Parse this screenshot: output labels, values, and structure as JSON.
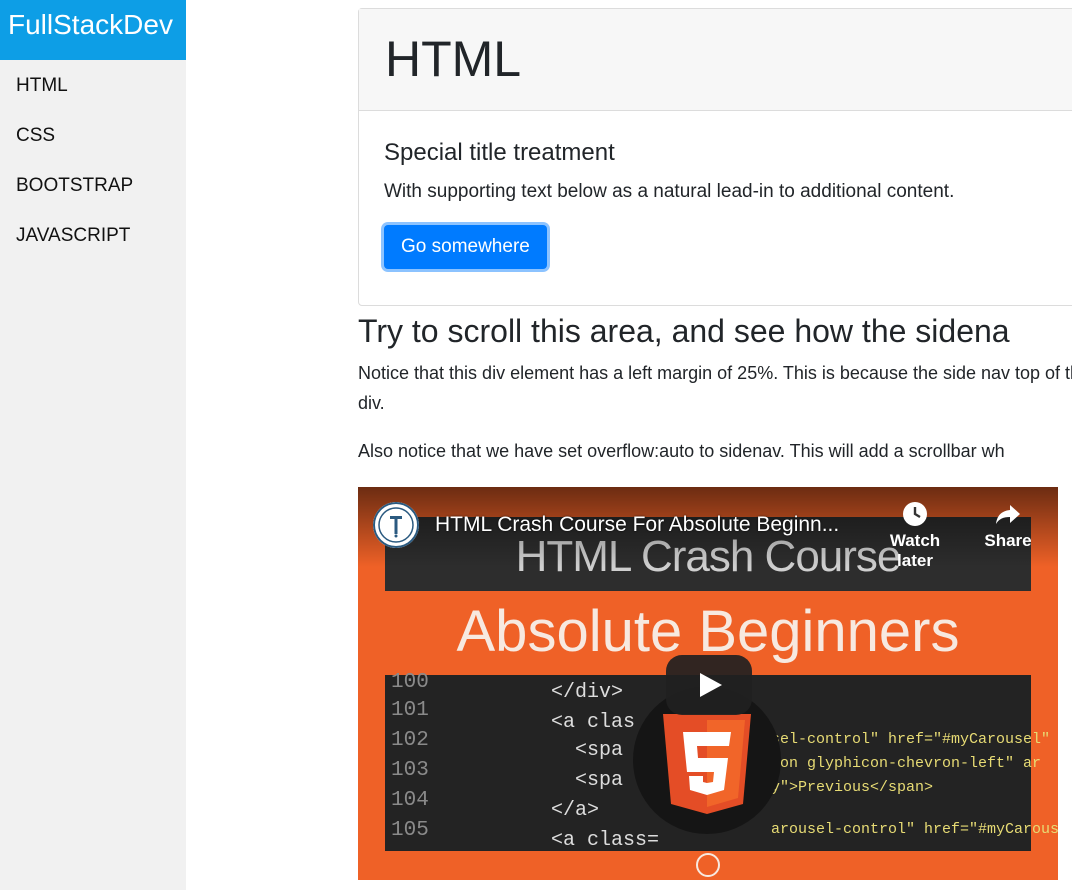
{
  "sidebar": {
    "brand": "FullStackDev",
    "items": [
      {
        "label": "HTML"
      },
      {
        "label": "CSS"
      },
      {
        "label": "BOOTSTRAP"
      },
      {
        "label": "JAVASCRIPT"
      }
    ]
  },
  "card": {
    "header": "HTML",
    "title": "Special title treatment",
    "text": "With supporting text below as a natural lead-in to additional content.",
    "button_label": "Go somewhere"
  },
  "content": {
    "heading": "Try to scroll this area, and see how the sidena",
    "paragraph1": "Notice that this div element has a left margin of 25%. This is because the side nav top of this div.",
    "paragraph2": "Also notice that we have set overflow:auto to sidenav. This will add a scrollbar wh"
  },
  "video": {
    "title": "HTML Crash Course For Absolute Beginn...",
    "watch_later": "Watch later",
    "share": "Share",
    "thumbnail_top_text": "HTML Crash Course",
    "thumbnail_title": "Absolute Beginners",
    "code_line_numbers": [
      "100",
      "101",
      "102",
      "103",
      "104",
      "105"
    ],
    "code_lines": [
      "</div>",
      "<a clas",
      "<spa",
      "<spa",
      "</a>",
      "<a class="
    ],
    "code_right_lines": [
      "sel-control\" href=\"#myCarousel\"",
      "con glyphicon-chevron-left\" ar",
      "y\">Previous</span>",
      "arousel-control\" href=\"#myCarousel\""
    ],
    "brand_color": "#ef6127",
    "icons": [
      "play-icon",
      "clock-icon",
      "share-icon",
      "html5-logo"
    ]
  }
}
